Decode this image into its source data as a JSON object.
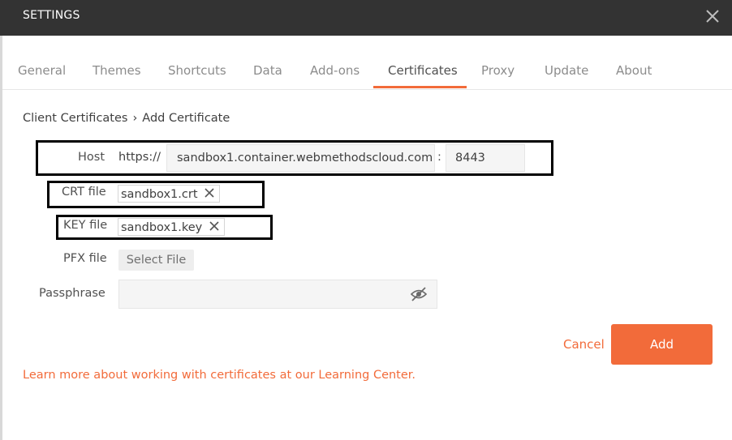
{
  "window": {
    "title": "SETTINGS",
    "close_icon": "close-icon"
  },
  "tabs": [
    {
      "label": "General"
    },
    {
      "label": "Themes"
    },
    {
      "label": "Shortcuts"
    },
    {
      "label": "Data"
    },
    {
      "label": "Add-ons"
    },
    {
      "label": "Certificates",
      "active": true
    },
    {
      "label": "Proxy"
    },
    {
      "label": "Update"
    },
    {
      "label": "About"
    }
  ],
  "breadcrumb": {
    "parent": "Client Certificates",
    "separator": "›",
    "current": "Add Certificate"
  },
  "form": {
    "host": {
      "label": "Host",
      "protocol": "https://",
      "value": "sandbox1.container.webmethodscloud.com",
      "port_separator": ":",
      "port": "8443"
    },
    "crt": {
      "label": "CRT file",
      "file": "sandbox1.crt"
    },
    "key": {
      "label": "KEY file",
      "file": "sandbox1.key"
    },
    "pfx": {
      "label": "PFX file",
      "button": "Select File"
    },
    "passphrase": {
      "label": "Passphrase",
      "value": "",
      "toggle_icon": "eye-slash-icon"
    }
  },
  "actions": {
    "cancel": "Cancel",
    "add": "Add"
  },
  "footer_link": "Learn more about working with certificates at our Learning Center.",
  "colors": {
    "accent": "#f26b3a",
    "titlebar": "#333333"
  }
}
